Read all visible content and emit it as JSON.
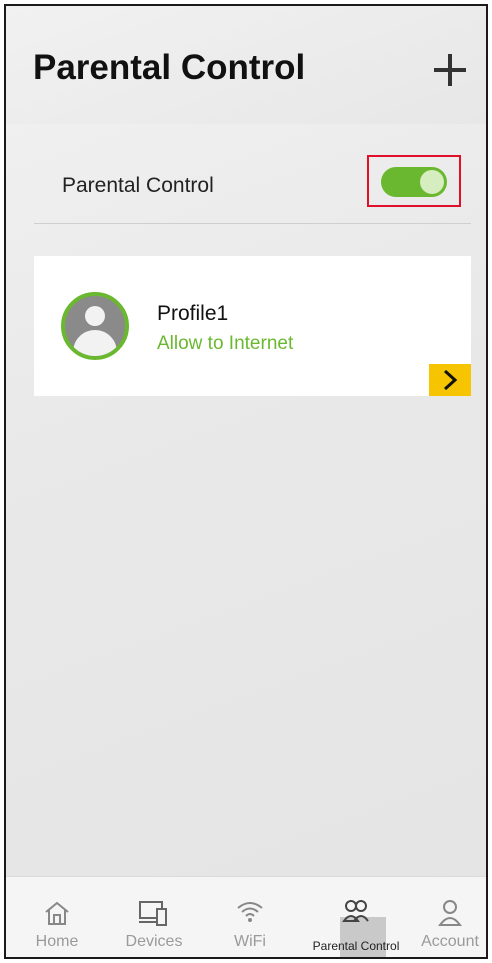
{
  "header": {
    "title": "Parental Control"
  },
  "parental_control_row": {
    "label": "Parental Control",
    "enabled": true
  },
  "profiles": [
    {
      "name": "Profile1",
      "status": "Allow to Internet"
    }
  ],
  "nav": {
    "items": [
      {
        "label": "Home",
        "icon": "home-icon"
      },
      {
        "label": "Devices",
        "icon": "devices-icon"
      },
      {
        "label": "WiFi",
        "icon": "wifi-icon"
      },
      {
        "label": "Parental Control",
        "icon": "parental-control-icon"
      },
      {
        "label": "Account",
        "icon": "account-icon"
      }
    ],
    "active": "Parental Control"
  },
  "colors": {
    "accent_green": "#6ab82f",
    "highlight_red": "#e0102a",
    "chevron_yellow": "#f6c400"
  }
}
